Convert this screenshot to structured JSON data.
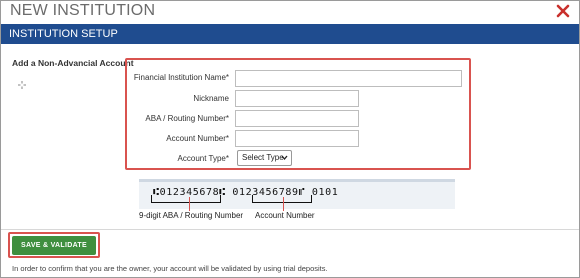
{
  "dialog": {
    "title": "NEW INSTITUTION",
    "close_icon": "close-icon"
  },
  "section": {
    "header": "INSTITUTION SETUP",
    "left_heading": "Add a Non-Advancial Account",
    "move_icon": "move-icon"
  },
  "form": {
    "fields": [
      {
        "label": "Financial Institution Name*",
        "value": ""
      },
      {
        "label": "Nickname",
        "value": ""
      },
      {
        "label": "ABA / Routing Number*",
        "value": ""
      },
      {
        "label": "Account Number*",
        "value": ""
      }
    ],
    "account_type": {
      "label": "Account Type*",
      "selected": "Select Type"
    }
  },
  "check_image": {
    "micr_line": "⑆012345678⑆ 0123456789⑈ 0101",
    "routing_caption": "9-digit ABA / Routing Number",
    "account_caption": "Account Number"
  },
  "actions": {
    "save_label": "SAVE & VALIDATE"
  },
  "footer": {
    "note": "In order to confirm that you are the owner, your account will be validated by using trial deposits."
  },
  "colors": {
    "header_bg": "#1f4c8f",
    "close_red": "#c9302c",
    "save_green": "#3f8f3f",
    "highlight_red": "#d9534f"
  }
}
